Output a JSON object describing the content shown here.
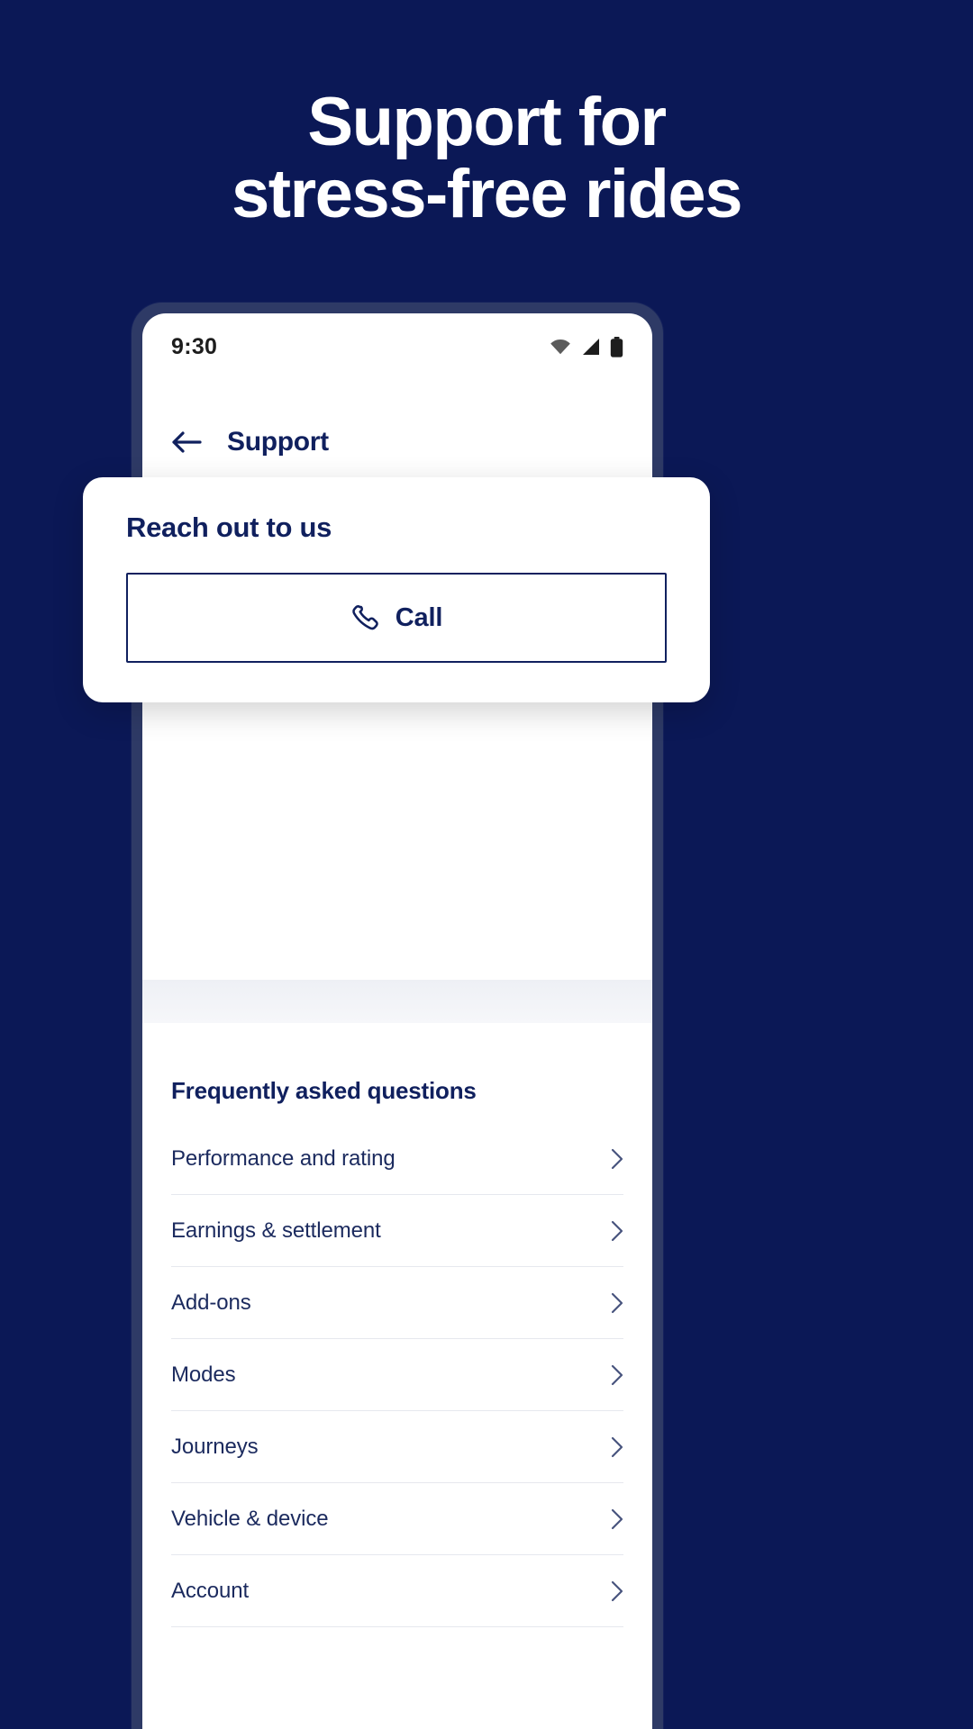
{
  "theme": {
    "background": "#0b1856",
    "navy": "#10205e",
    "phone_frame": "#2e3a66",
    "card_bg": "#ffffff",
    "divider": "#e6e8ee"
  },
  "hero": {
    "line1": "Support for",
    "line2": "stress-free rides"
  },
  "phone": {
    "status_bar": {
      "time": "9:30",
      "icons": [
        "wifi-icon",
        "signal-icon",
        "battery-icon"
      ]
    },
    "navbar": {
      "back_icon": "arrow-left-icon",
      "title": "Support"
    },
    "reach_card": {
      "title": "Reach out to us",
      "call_button": {
        "label": "Call",
        "icon": "phone-handset-icon"
      }
    },
    "faq": {
      "title": "Frequently asked questions",
      "items": [
        {
          "label": "Performance and rating",
          "chevron": "chevron-right-icon"
        },
        {
          "label": "Earnings & settlement",
          "chevron": "chevron-right-icon"
        },
        {
          "label": "Add-ons",
          "chevron": "chevron-right-icon"
        },
        {
          "label": "Modes",
          "chevron": "chevron-right-icon"
        },
        {
          "label": "Journeys",
          "chevron": "chevron-right-icon"
        },
        {
          "label": "Vehicle & device",
          "chevron": "chevron-right-icon"
        },
        {
          "label": "Account",
          "chevron": "chevron-right-icon"
        }
      ]
    }
  }
}
